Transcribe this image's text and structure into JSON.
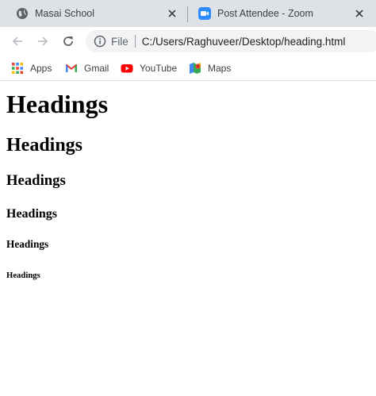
{
  "browser": {
    "tabs": [
      {
        "title": "Masai School",
        "icon": "globe-icon",
        "close_icon": "close-icon"
      },
      {
        "title": "Post Attendee - Zoom",
        "icon": "zoom-icon",
        "close_icon": "close-icon"
      }
    ],
    "toolbar": {
      "back_icon": "back-arrow-icon",
      "forward_icon": "forward-arrow-icon",
      "reload_icon": "reload-icon",
      "security_chip": "File",
      "url": "C:/Users/Raghuveer/Desktop/heading.html"
    },
    "bookmarks": [
      {
        "label": "Apps",
        "icon": "apps-grid-icon"
      },
      {
        "label": "Gmail",
        "icon": "gmail-icon"
      },
      {
        "label": "YouTube",
        "icon": "youtube-icon"
      },
      {
        "label": "Maps",
        "icon": "maps-icon"
      }
    ],
    "colors": {
      "tabstrip": "#dee1e6",
      "omnibox": "#f1f3f4",
      "zoom_blue": "#2d8cff",
      "youtube_red": "#ff0000"
    }
  },
  "page": {
    "h1": "Headings",
    "h2": "Headings",
    "h3": "Headings",
    "h4": "Headings",
    "h5": "Headings",
    "h6": "Headings"
  }
}
